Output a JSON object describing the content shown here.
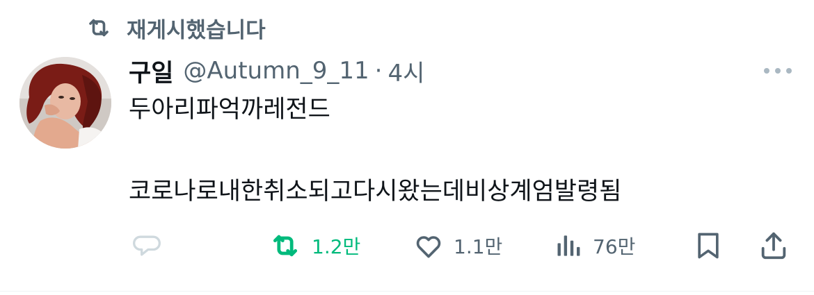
{
  "repost_header": {
    "label": "재게시했습니다",
    "icon": "repost-icon"
  },
  "author": {
    "display_name": "구일",
    "handle": "@Autumn_9_11",
    "separator": "·",
    "time": "4시"
  },
  "tweet": {
    "line1": "두아리파억까레전드",
    "line2": "코로나로내한취소되고다시왔는데비상계엄발령됨"
  },
  "actions": {
    "reply": {
      "icon": "reply-icon",
      "count": ""
    },
    "repost": {
      "icon": "repost-icon",
      "count": "1.2만",
      "active_color": "#00ba7c"
    },
    "like": {
      "icon": "heart-icon",
      "count": "1.1만"
    },
    "views": {
      "icon": "views-icon",
      "count": "76만"
    },
    "bookmark": {
      "icon": "bookmark-icon"
    },
    "share": {
      "icon": "share-icon"
    }
  },
  "colors": {
    "text": "#0f1419",
    "secondary": "#536471",
    "repost_green": "#00ba7c",
    "divider": "#eff3f4"
  }
}
